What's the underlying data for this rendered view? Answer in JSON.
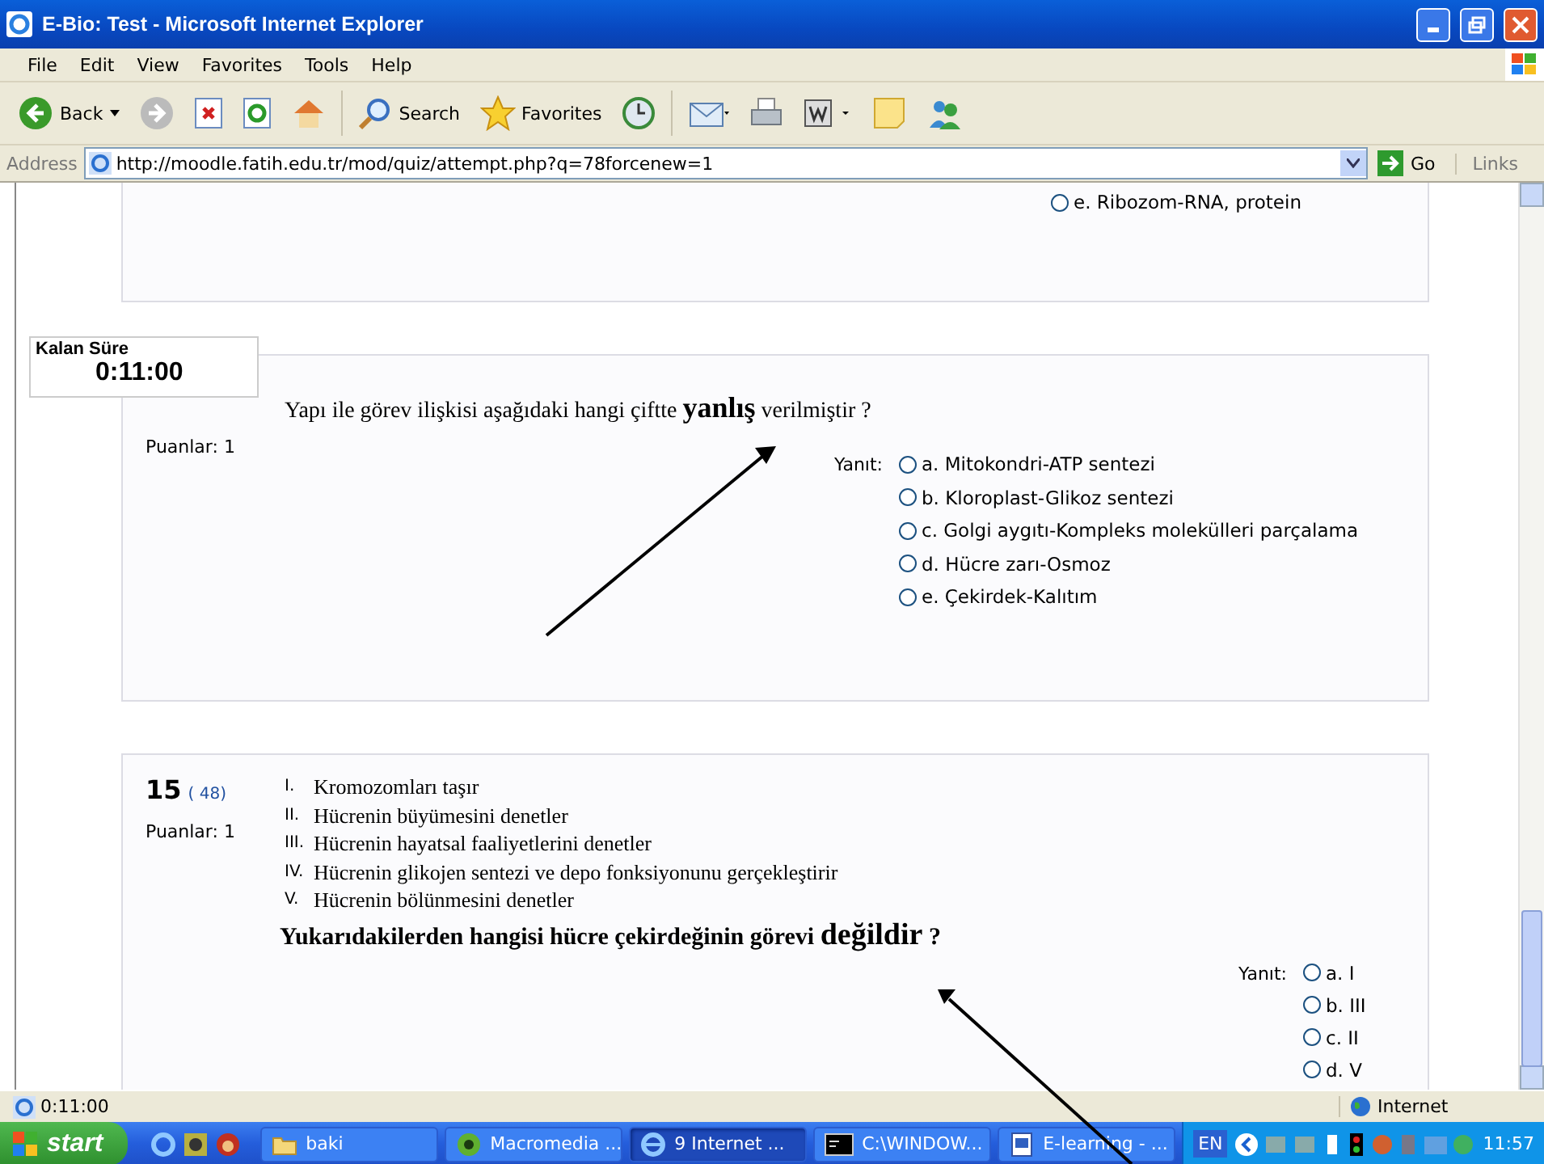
{
  "window": {
    "title": "E-Bio: Test - Microsoft Internet Explorer"
  },
  "menu": [
    "File",
    "Edit",
    "View",
    "Favorites",
    "Tools",
    "Help"
  ],
  "toolbar": [
    {
      "kind": "back",
      "label": "Back"
    },
    {
      "kind": "forward"
    },
    {
      "kind": "stop"
    },
    {
      "kind": "refresh"
    },
    {
      "kind": "home"
    },
    {
      "kind": "search",
      "label": "Search"
    },
    {
      "kind": "favorites",
      "label": "Favorites"
    },
    {
      "kind": "history"
    },
    {
      "kind": "mail"
    },
    {
      "kind": "print"
    },
    {
      "kind": "word"
    },
    {
      "kind": "note"
    },
    {
      "kind": "messenger"
    }
  ],
  "address": {
    "label": "Address",
    "url": "http://moodle.fatih.edu.tr/mod/quiz/attempt.php?q=78forcenew=1",
    "go": "Go",
    "links": "Links"
  },
  "previous_question": {
    "options": [
      {
        "label": "e. Ribozom-RNA, protein",
        "selected": false
      }
    ]
  },
  "timer": {
    "label": "Kalan Süre",
    "time": "0:11:00"
  },
  "questions": [
    {
      "points": "Puanlar: 1",
      "text": "Yapı ile görev ilişkisi aşağıdaki hangi çiftte **yanlış** verilmiştir ?",
      "answer_label": "Yanıt:",
      "options": [
        {
          "label": "a. Mitokondri-ATP sentezi",
          "selected": false
        },
        {
          "label": "b. Kloroplast-Glikoz sentezi",
          "selected": false
        },
        {
          "label": "c. Golgi aygıtı-Kompleks molekülleri parçalama",
          "selected": false
        },
        {
          "label": "d. Hücre zarı-Osmoz",
          "selected": false
        },
        {
          "label": "e. Çekirdek-Kalıtım",
          "selected": false
        }
      ]
    },
    {
      "number": "15",
      "ref": "( 48)",
      "points": "Puanlar: 1",
      "text": "Yukarıdakilerden hangisi hücre çekirdeğinin görevi **değildir** ?",
      "answer_label": "Yanıt:",
      "statements": [
        {
          "numeral": "I.",
          "text": "Kromozomları taşır"
        },
        {
          "numeral": "II.",
          "text": "Hücrenin büyümesini denetler"
        },
        {
          "numeral": "III.",
          "text": "Hücrenin hayatsal faaliyetlerini denetler"
        },
        {
          "numeral": "IV.",
          "text": "Hücrenin glikojen sentezi ve depo fonksiyonunu gerçekleştirir"
        },
        {
          "numeral": "V.",
          "text": "Hücrenin bölünmesini denetler"
        }
      ],
      "options": [
        {
          "label": "a. I",
          "selected": false
        },
        {
          "label": "b. III",
          "selected": false
        },
        {
          "label": "c. II",
          "selected": false
        },
        {
          "label": "d. V",
          "selected": false
        }
      ]
    }
  ],
  "status_bar": {
    "text": "0:11:00",
    "zone": "Internet"
  },
  "taskbar": {
    "start": "start",
    "tasks": [
      {
        "kind": "folder",
        "label": "baki",
        "selected": false
      },
      {
        "kind": "app",
        "label": "Macromedia ...",
        "selected": false
      },
      {
        "kind": "ie",
        "label": "9 Internet ...",
        "selected": true
      },
      {
        "kind": "console",
        "label": "C:\\WINDOW...",
        "selected": false
      },
      {
        "kind": "doc",
        "label": "E-learning - ...",
        "selected": false
      }
    ],
    "language": "EN",
    "clock": "11:57"
  }
}
